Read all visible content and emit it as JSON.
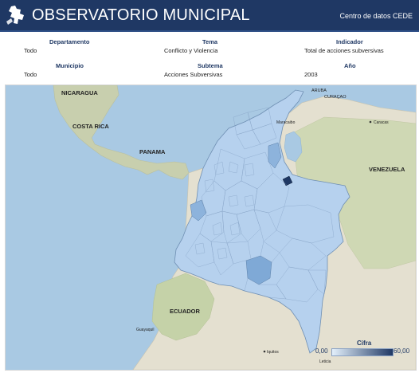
{
  "header": {
    "title": "OBSERVATORIO MUNICIPAL",
    "subtitle": "Centro de datos CEDE",
    "logo_icon": "colombia-map-icon"
  },
  "filters": {
    "departamento": {
      "label": "Departamento",
      "value": "Todo"
    },
    "tema": {
      "label": "Tema",
      "value": "Conflicto y Violencia"
    },
    "indicador": {
      "label": "Indicador",
      "value": "Total de acciones subversivas"
    },
    "municipio": {
      "label": "Municipio",
      "value": "Todo"
    },
    "subtema": {
      "label": "Subtema",
      "value": "Acciones Subversivas"
    },
    "anio": {
      "label": "Año",
      "value": "2003"
    }
  },
  "map": {
    "labels": {
      "nicaragua": "NICARAGUA",
      "costa_rica": "COSTA RICA",
      "panama": "PANAMA",
      "venezuela": "VENEZUELA",
      "ecuador": "ECUADOR",
      "aruba": "ARUBA",
      "curacao": "CURAÇAO",
      "caracas": "Caracas",
      "maracaibo": "Maracaibo",
      "guayaquil": "Guayaquil",
      "iquitos": "Iquitos",
      "leticia": "Leticia"
    },
    "colors": {
      "ocean": "#a9c9e3",
      "land": "#e6e2d4",
      "green_land": "#c5d2a8",
      "colombia_fill": "#b6d1ee",
      "colombia_border": "#6f8fb3",
      "high_value": "#1f3864"
    }
  },
  "legend": {
    "title": "Cifra",
    "min_label": "0,00",
    "max_label": "60,00",
    "min_value": 0,
    "max_value": 60
  }
}
